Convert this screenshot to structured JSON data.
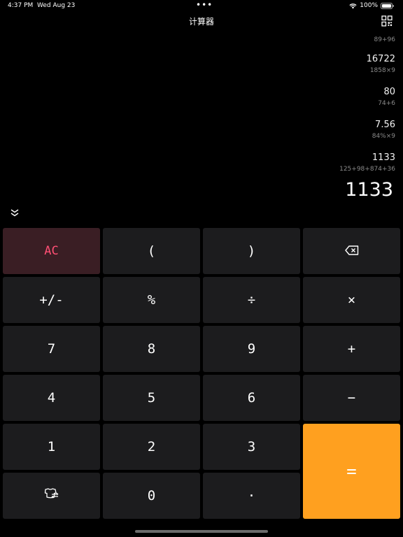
{
  "status": {
    "time": "4:37 PM",
    "date": "Wed Aug 23",
    "dots": "•••",
    "battery": "100%"
  },
  "header": {
    "title": "计算器"
  },
  "history": [
    {
      "result": "",
      "expr": "89+96"
    },
    {
      "result": "16722",
      "expr": "1858×9"
    },
    {
      "result": "80",
      "expr": "74+6"
    },
    {
      "result": "7.56",
      "expr": "84%×9"
    },
    {
      "result": "1133",
      "expr": "125+98+874+36"
    }
  ],
  "display": {
    "value": "1133"
  },
  "keys": {
    "ac": "AC",
    "lparen": "(",
    "rparen": ")",
    "plusminus": "+/-",
    "percent": "%",
    "divide": "÷",
    "multiply": "×",
    "seven": "7",
    "eight": "8",
    "nine": "9",
    "plus": "+",
    "four": "4",
    "five": "5",
    "six": "6",
    "minus": "−",
    "one": "1",
    "two": "2",
    "three": "3",
    "equals": "=",
    "zero": "0",
    "decimal": "·"
  },
  "colors": {
    "background": "#000000",
    "key": "#1c1c1e",
    "ac_bg": "#3a1e24",
    "ac_text": "#ff4f74",
    "equals_bg": "#ffa01f"
  },
  "icons": {
    "backspace": "backspace-icon",
    "convert": "unit-convert-icon",
    "qr": "qr-grid-icon",
    "collapse": "double-chevron-down-icon"
  }
}
